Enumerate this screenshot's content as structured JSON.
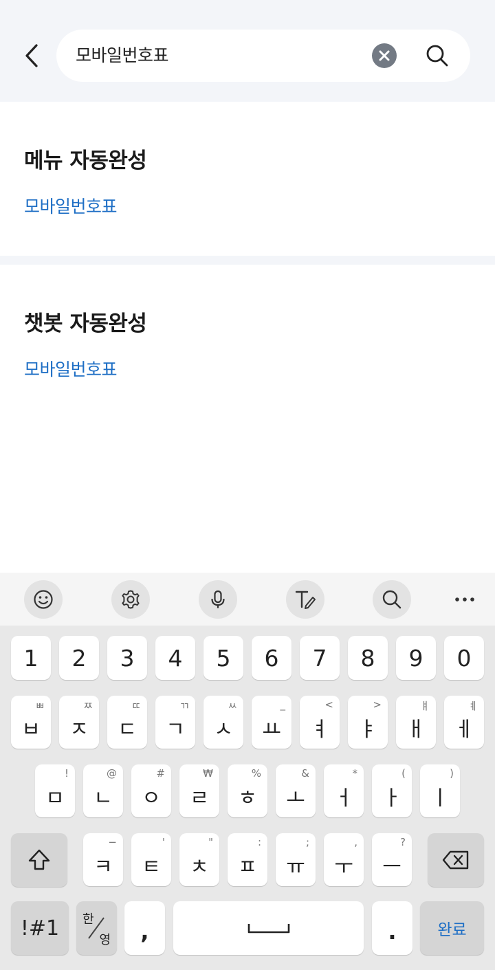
{
  "header": {
    "search_value": "모바일번호표",
    "back_icon": "chevron-left-icon",
    "clear_icon": "clear-circle-icon",
    "search_icon": "search-icon"
  },
  "menu_section": {
    "title": "메뉴 자동완성",
    "item": "모바일번호표"
  },
  "chatbot_section": {
    "title": "챗봇 자동완성",
    "item": "모바일번호표"
  },
  "keyboard": {
    "toolbar": [
      "emoji-icon",
      "settings-icon",
      "microphone-icon",
      "handwriting-icon",
      "search-icon",
      "more-icon"
    ],
    "number_row": [
      "1",
      "2",
      "3",
      "4",
      "5",
      "6",
      "7",
      "8",
      "9",
      "0"
    ],
    "row1": [
      {
        "main": "ㅂ",
        "sub": "ㅃ"
      },
      {
        "main": "ㅈ",
        "sub": "ㅉ"
      },
      {
        "main": "ㄷ",
        "sub": "ㄸ"
      },
      {
        "main": "ㄱ",
        "sub": "ㄲ"
      },
      {
        "main": "ㅅ",
        "sub": "ㅆ"
      },
      {
        "main": "ㅛ",
        "sub": "_"
      },
      {
        "main": "ㅕ",
        "sub": "<"
      },
      {
        "main": "ㅑ",
        "sub": ">"
      },
      {
        "main": "ㅐ",
        "sub": "ㅒ"
      },
      {
        "main": "ㅔ",
        "sub": "ㅖ"
      }
    ],
    "row2": [
      {
        "main": "ㅁ",
        "sub": "!"
      },
      {
        "main": "ㄴ",
        "sub": "@"
      },
      {
        "main": "ㅇ",
        "sub": "#"
      },
      {
        "main": "ㄹ",
        "sub": "₩"
      },
      {
        "main": "ㅎ",
        "sub": "%"
      },
      {
        "main": "ㅗ",
        "sub": "&"
      },
      {
        "main": "ㅓ",
        "sub": "*"
      },
      {
        "main": "ㅏ",
        "sub": "("
      },
      {
        "main": "ㅣ",
        "sub": ")"
      }
    ],
    "row3": [
      {
        "main": "ㅋ",
        "sub": "−"
      },
      {
        "main": "ㅌ",
        "sub": "'"
      },
      {
        "main": "ㅊ",
        "sub": "\""
      },
      {
        "main": "ㅍ",
        "sub": ":"
      },
      {
        "main": "ㅠ",
        "sub": ";"
      },
      {
        "main": "ㅜ",
        "sub": ","
      },
      {
        "main": "ㅡ",
        "sub": "?"
      }
    ],
    "symbols_label": "!#1",
    "lang_top": "한",
    "lang_bottom": "영",
    "comma": ",",
    "period": ".",
    "done_label": "완료",
    "done_color": "#1f6fc5"
  }
}
